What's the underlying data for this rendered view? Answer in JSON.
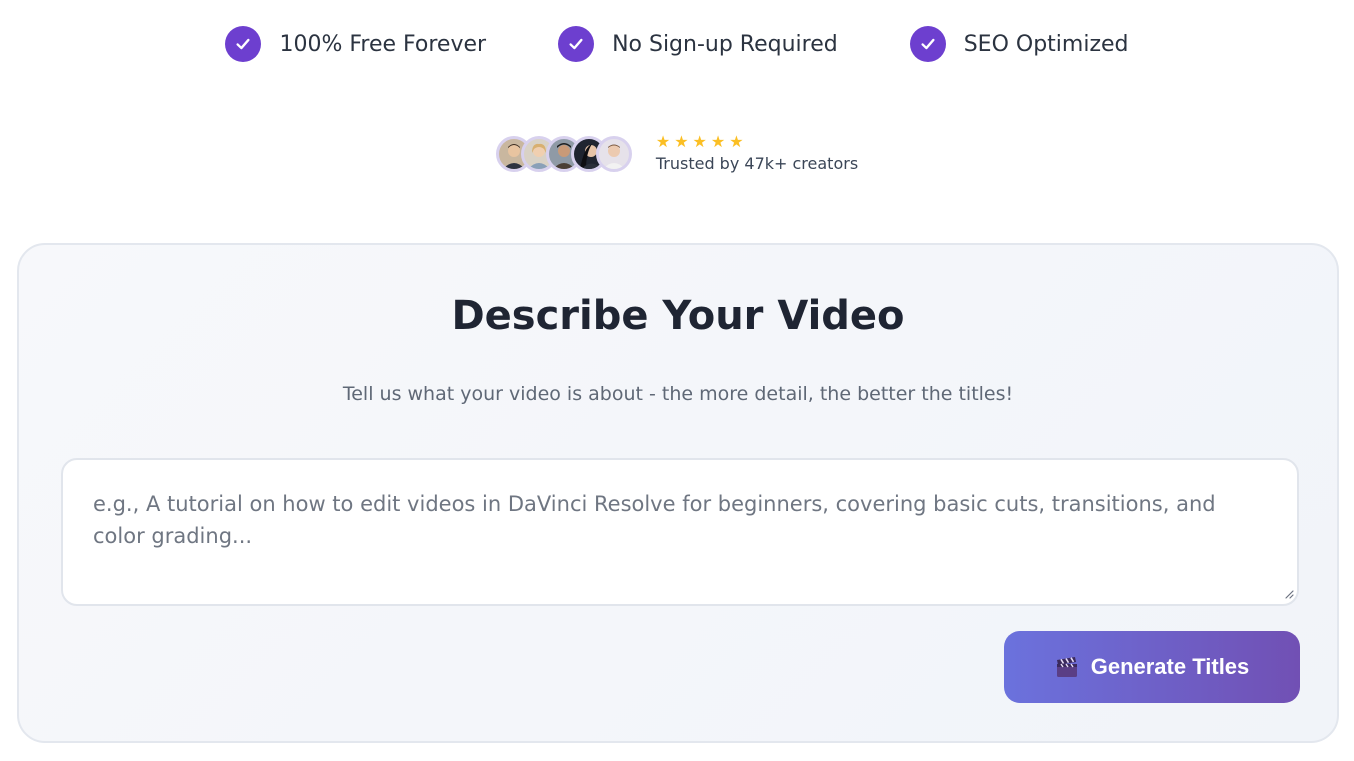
{
  "features": [
    {
      "label": "100% Free Forever",
      "icon": "check-circle-icon"
    },
    {
      "label": "No Sign-up Required",
      "icon": "check-circle-icon"
    },
    {
      "label": "SEO Optimized",
      "icon": "check-circle-icon"
    }
  ],
  "trust": {
    "rating_stars": 5,
    "star_glyph": "★",
    "label": "Trusted by 47k+ creators",
    "avatar_count": 5
  },
  "card": {
    "title": "Describe Your Video",
    "subtitle": "Tell us what your video is about - the more detail, the better the titles!",
    "textarea": {
      "value": "",
      "placeholder": "e.g., A tutorial on how to edit videos in DaVinci Resolve for beginners, covering basic cuts, transitions, and color grading..."
    },
    "generate_button": {
      "icon": "clapperboard-icon",
      "label": "Generate Titles"
    }
  },
  "colors": {
    "accent": "#6d3fcf",
    "star": "#fbbf24",
    "button_gradient_start": "#6b72dd",
    "button_gradient_end": "#7150b4"
  }
}
